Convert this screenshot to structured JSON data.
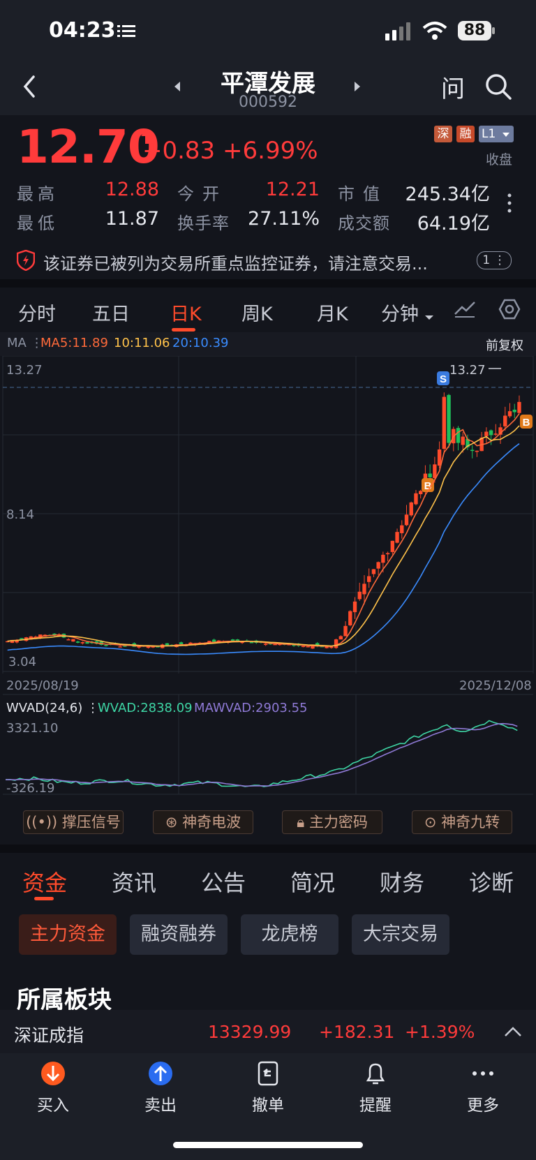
{
  "status_bar": {
    "time": "04:23",
    "battery": "88"
  },
  "header": {
    "name": "平潭发展",
    "code": "000592",
    "ask_label": "问"
  },
  "quote": {
    "price": "12.70",
    "change": "+0.83",
    "change_pct": "+6.99%",
    "tags": [
      "深",
      "融",
      "L1"
    ],
    "market_state": "收盘",
    "fields": [
      {
        "label": "最高",
        "value": "12.88",
        "color": "#ff3b3b"
      },
      {
        "label": "今开",
        "value": "12.21",
        "color": "#ff3b3b"
      },
      {
        "label": "市值",
        "value": "245.34亿",
        "color": "#e6e8ee"
      },
      {
        "label": "最低",
        "value": "11.87",
        "color": "#e6e8ee"
      },
      {
        "label": "换手率",
        "value": "27.11%",
        "color": "#e6e8ee"
      },
      {
        "label": "成交额",
        "value": "64.19亿",
        "color": "#e6e8ee"
      }
    ]
  },
  "warning": {
    "text": "该证券已被列为交易所重点监控证券，请注意交易...",
    "badge": "1"
  },
  "chart_tabs": [
    "分时",
    "五日",
    "日K",
    "周K",
    "月K",
    "分钟"
  ],
  "active_chart_tab": "日K",
  "ma_row": {
    "label": "MA",
    "ma5": "MA5:11.89",
    "ma10": "10:11.06",
    "ma20": "20:10.39",
    "adjust": "前复权"
  },
  "chart_data": {
    "type": "candlestick",
    "y_top_label": "13.27",
    "y_mid_label": "8.14",
    "y_bottom_label": "3.04",
    "high_marker": "13.27",
    "date_start": "2025/08/19",
    "date_end": "2025/12/08",
    "ylim": [
      3.04,
      13.27
    ],
    "markers": [
      "S",
      "B",
      "B"
    ],
    "colors": {
      "up": "#ff4b2b",
      "down": "#1fbf5a",
      "ma5": "#ff6a3a",
      "ma10": "#ffc24a",
      "ma20": "#3a8cff"
    }
  },
  "indicator": {
    "name": "WVAD(24,6)",
    "wvad": "WVAD:2838.09",
    "mawvad": "MAWVAD:2903.55",
    "top_label": "3321.10",
    "bottom_label": "-326.19"
  },
  "indicator_buttons": [
    "撑压信号",
    "神奇电波",
    "主力密码",
    "神奇九转"
  ],
  "section_tabs": [
    "资金",
    "资讯",
    "公告",
    "简况",
    "财务",
    "诊断"
  ],
  "active_section_tab": "资金",
  "chips": [
    "主力资金",
    "融资融券",
    "龙虎榜",
    "大宗交易"
  ],
  "sector": {
    "title": "所属板块",
    "index_name": "深证成指",
    "index_value": "13329.99",
    "index_change": "+182.31",
    "index_pct": "+1.39%"
  },
  "bottom_bar": [
    "买入",
    "卖出",
    "撤单",
    "提醒",
    "更多"
  ]
}
